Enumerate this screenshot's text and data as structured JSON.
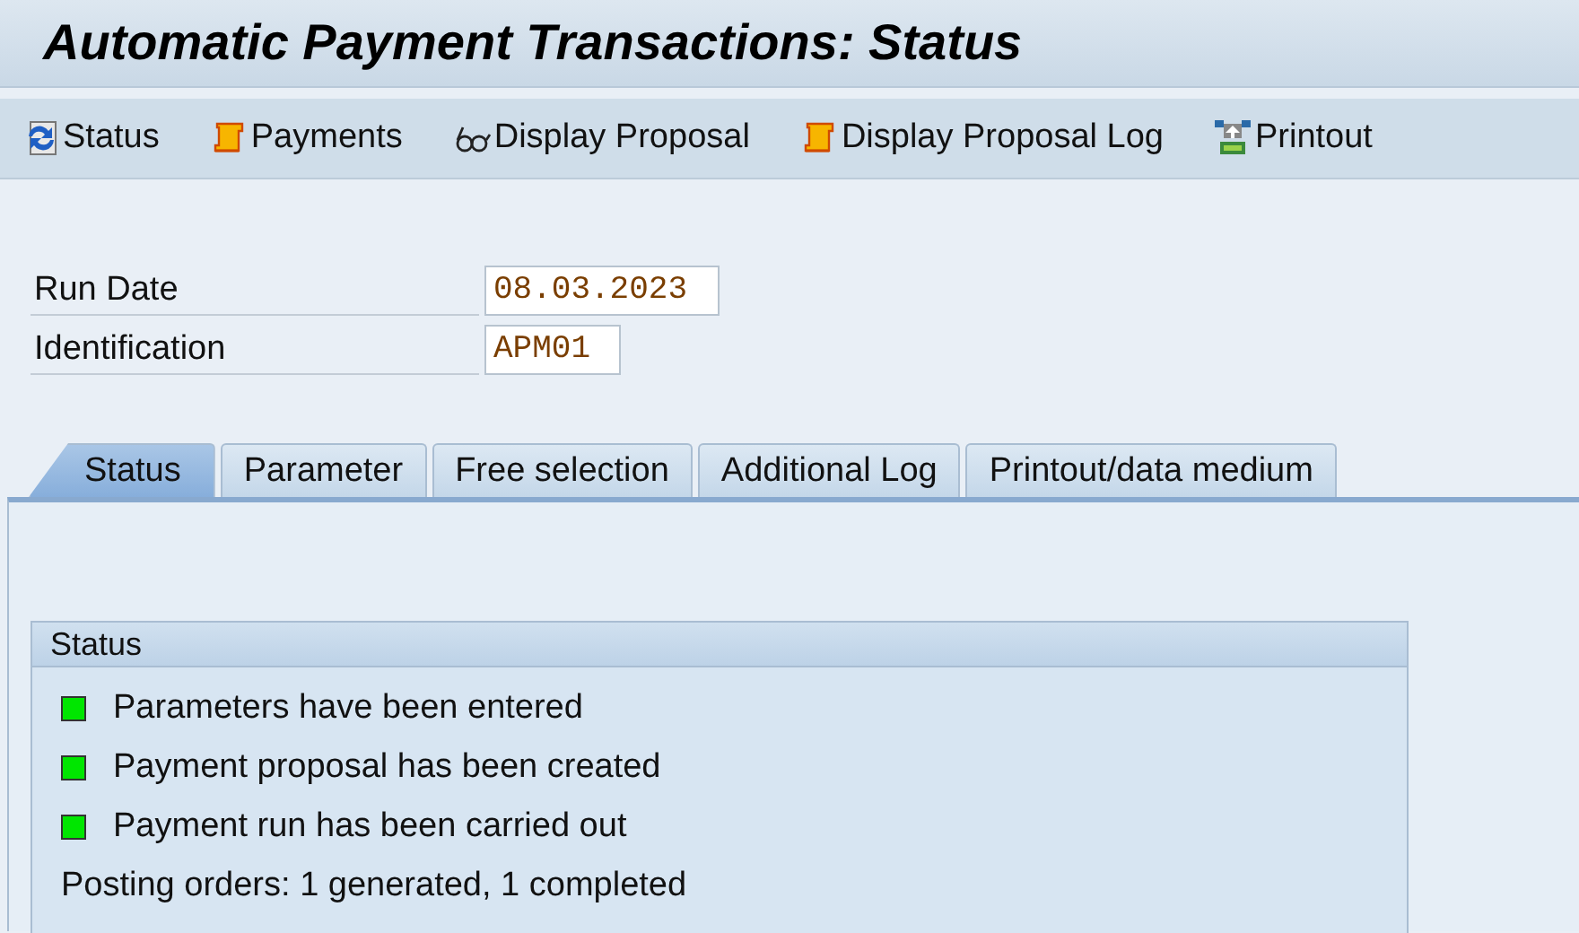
{
  "window": {
    "title": "Automatic Payment Transactions: Status"
  },
  "toolbar": [
    {
      "label": "Status",
      "kind": "refresh"
    },
    {
      "label": "Payments",
      "kind": "scroll"
    },
    {
      "label": "Display Proposal",
      "kind": "glasses"
    },
    {
      "label": "Display Proposal Log",
      "kind": "scroll"
    },
    {
      "label": "Printout",
      "kind": "print"
    }
  ],
  "fields": [
    {
      "label": "Run Date",
      "value": "08.03.2023"
    },
    {
      "label": "Identification",
      "value": "APM01"
    }
  ],
  "tabs": [
    {
      "label": "Status",
      "selected": true
    },
    {
      "label": "Parameter",
      "selected": false
    },
    {
      "label": "Free selection",
      "selected": false
    },
    {
      "label": "Additional Log",
      "selected": false
    },
    {
      "label": "Printout/data medium",
      "selected": false
    }
  ],
  "status_group": {
    "title": "Status",
    "items": [
      {
        "text": "Parameters have been entered",
        "color": "#00e600"
      },
      {
        "text": "Payment proposal has been created",
        "color": "#00e600"
      },
      {
        "text": "Payment run has been carried out",
        "color": "#00e600"
      }
    ],
    "summary": "Posting orders: 1 generated, 1 completed"
  }
}
